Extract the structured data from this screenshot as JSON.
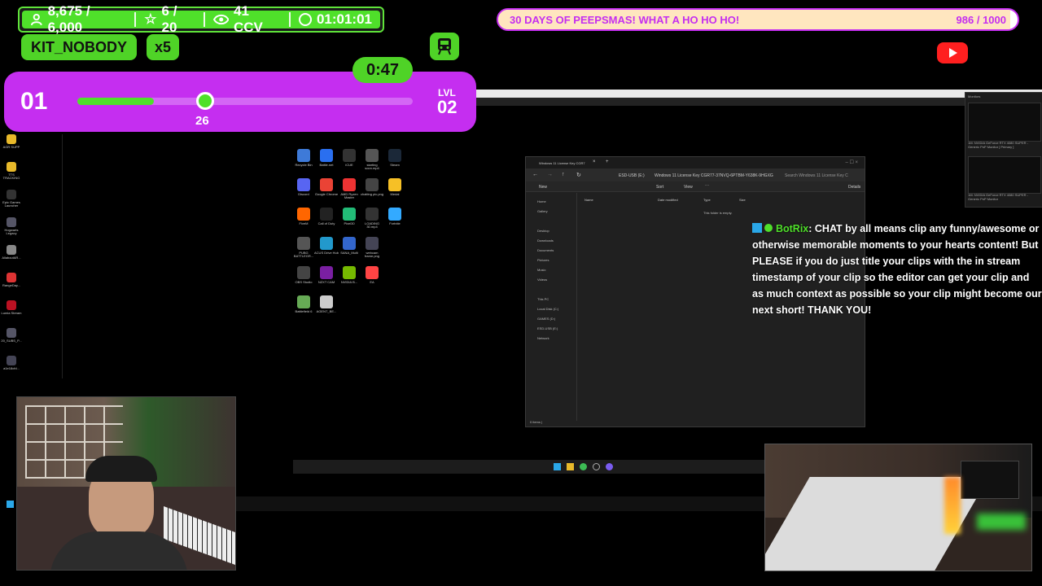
{
  "stats": {
    "followers": "8,675 / 6,000",
    "stars": "6 / 20",
    "viewers": "41 CCV",
    "timer": "01:01:01"
  },
  "viewer": {
    "name": "KIT_NOBODY",
    "multiplier": "x5"
  },
  "countdown": "0:47",
  "xp": {
    "current_level": "01",
    "next_level_label": "LVL",
    "next_level": "02",
    "value": "26",
    "progress_fraction": 0.38
  },
  "goal": {
    "label": "30 DAYS OF PEEPSMAS! WHAT A HO HO HO!",
    "count": "986 / 1000",
    "progress_fraction": 0.986
  },
  "chat": {
    "user": "BotRix",
    "message": ": CHAT by all means clip any funny/awesome or otherwise memorable moments to your hearts content! But PLEASE if you do just title your clips with the in stream timestamp of your clip so the editor can get your clip and as much context as possible so your clip might become our next short! THANK YOU!"
  },
  "explorer": {
    "tab_title": "Windows 11 License Key CGR7",
    "address": "Windows 11 License Key CGR77-37NVQ-6PTBM-Y638K-9HGXG",
    "drive": "ESD-USB (E:)",
    "search_placeholder": "Search Windows 11 License Key C",
    "new_label": "New",
    "sort_label": "Sort",
    "view_label": "View",
    "details_label": "Details",
    "columns": [
      "Name",
      "Date modified",
      "Type",
      "Size"
    ],
    "empty_message": "This folder is empty.",
    "status": "0 items |",
    "nav_top": [
      "Home",
      "Gallery"
    ],
    "nav_quick": [
      "Desktop",
      "Downloads",
      "Documents",
      "Pictures",
      "Music",
      "Videos"
    ],
    "nav_pc": [
      "This PC",
      "Local Disk (C:)",
      "GAMES (D:)",
      "ESD-USB (E:)",
      "Network"
    ]
  },
  "desktop_icons_center": [
    "Recycle Bin",
    "Battle.net",
    "iCUE",
    "starting soon.mp4",
    "Steam",
    "Discord",
    "Google Chrome",
    "AMD Ryzen Master",
    "chatting pic.png",
    "Medal",
    "FiveM",
    "Call of Duty",
    "Pixel30",
    "LOADING 30.mp4",
    "Fortnite",
    "PUBG BATTLEGR...",
    "ACUS Drive Hub",
    "SANA_Multi",
    "webcam frame.png",
    "",
    "OBS Studio",
    "NZXT CAM",
    "NVIDIA B...",
    "EA",
    "",
    "Battlefield 6",
    "AGENT_BE..."
  ],
  "desktop_icons_left": [
    "AGR SUPP",
    "TTS TRACKING",
    "Epic Games Launcher",
    "Hogwarts Legacy",
    "AllaboutAR...",
    "RangeDay...",
    "Lumia Stream",
    "20_SUBS_P...",
    "a1e18cfd..."
  ],
  "monitors": {
    "title": "Monitors",
    "items": [
      "1M: NVIDIA GeForce RTX 4080 SUPER - Generic PnP Monitor [ Primary ]",
      "1M: NVIDIA GeForce RTX 4080 SUPER - Generic PnP Monitor"
    ]
  },
  "colors": {
    "green": "#4fe02a",
    "purple": "#c52ef0",
    "cream": "#ffe6bf"
  }
}
